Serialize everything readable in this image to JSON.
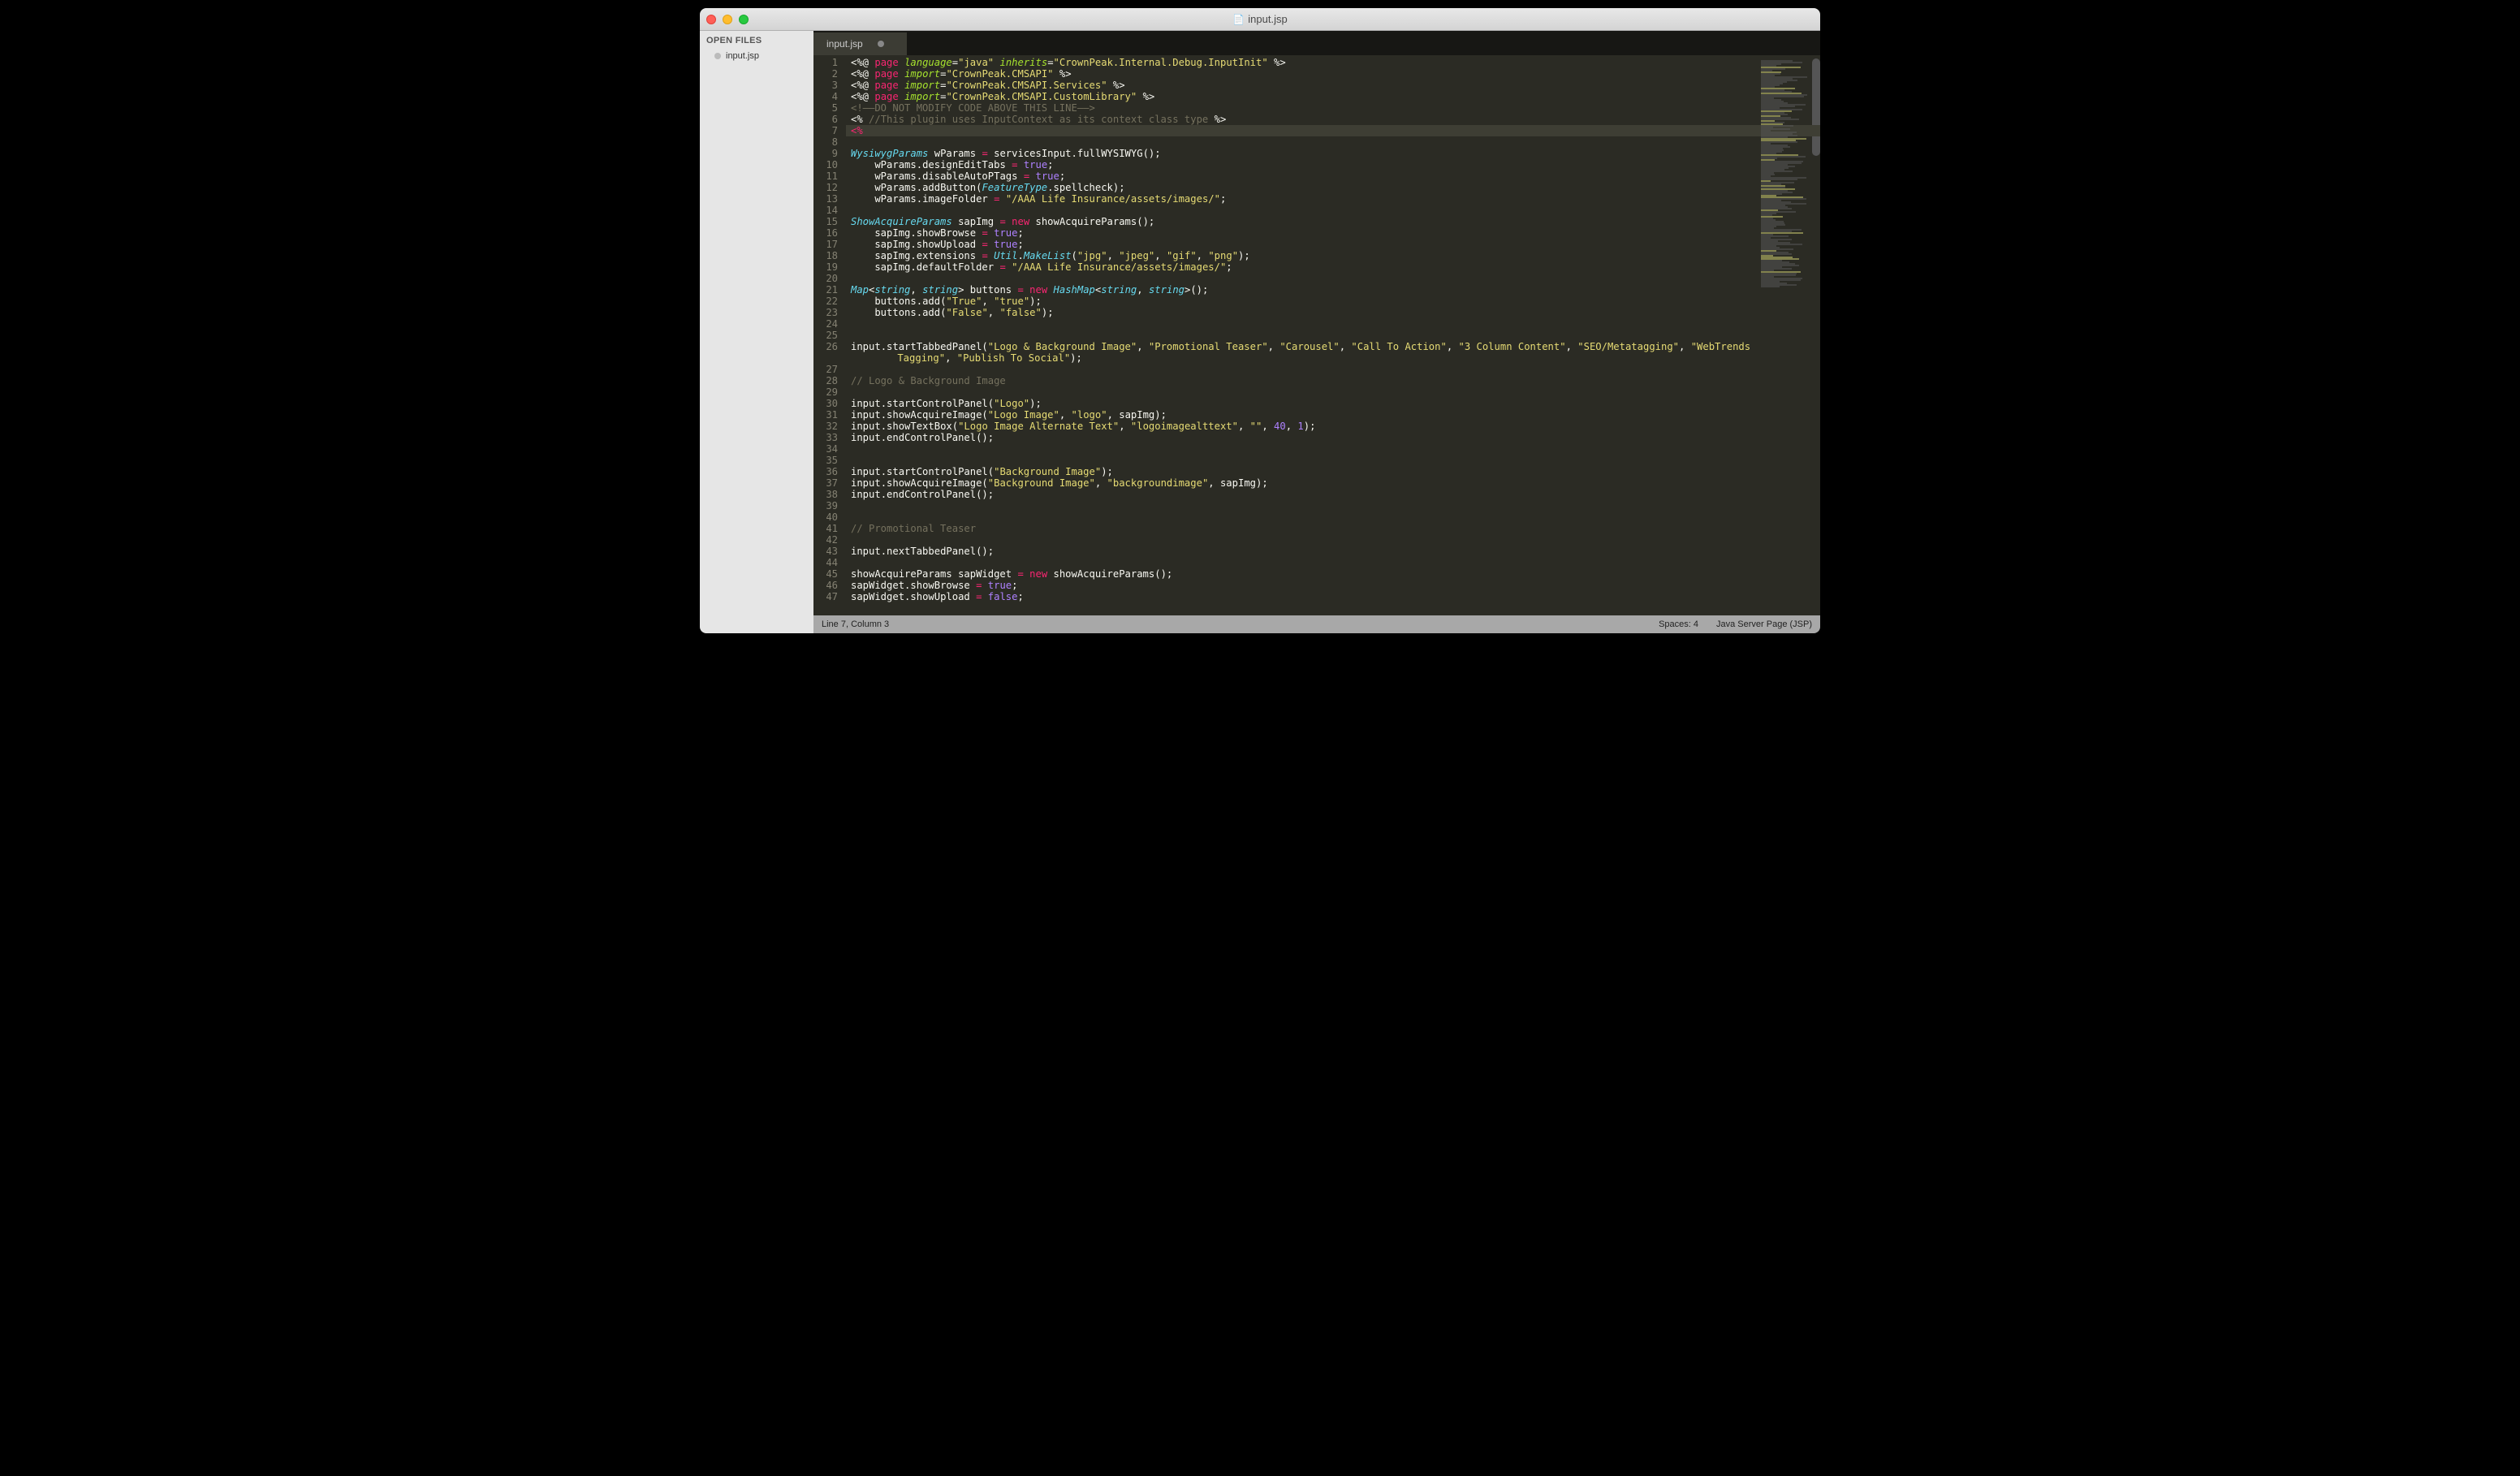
{
  "window": {
    "title": "input.jsp"
  },
  "sidebar": {
    "header": "OPEN FILES",
    "items": [
      "input.jsp"
    ]
  },
  "tab": {
    "label": "input.jsp"
  },
  "status": {
    "left": "Line 7, Column 3",
    "spaces": "Spaces: 4",
    "syntax": "Java Server Page (JSP)"
  },
  "highlight_line": 7,
  "gutter": [
    "1",
    "2",
    "3",
    "4",
    "5",
    "6",
    "7",
    "8",
    "9",
    "10",
    "11",
    "12",
    "13",
    "14",
    "15",
    "16",
    "17",
    "18",
    "19",
    "20",
    "21",
    "22",
    "23",
    "24",
    "25",
    "26",
    "",
    "27",
    "28",
    "29",
    "30",
    "31",
    "32",
    "33",
    "34",
    "35",
    "36",
    "37",
    "38",
    "39",
    "40",
    "41",
    "42",
    "43",
    "44",
    "45",
    "46",
    "47"
  ],
  "code": [
    [
      [
        "<%@ ",
        "t-tag"
      ],
      [
        "page",
        "t-key"
      ],
      [
        " ",
        ""
      ],
      [
        "language",
        "t-attr"
      ],
      [
        "=",
        ""
      ],
      [
        "\"java\"",
        "t-str"
      ],
      [
        " ",
        ""
      ],
      [
        "inherits",
        "t-attr"
      ],
      [
        "=",
        ""
      ],
      [
        "\"CrownPeak.Internal.Debug.InputInit\"",
        "t-str"
      ],
      [
        " %>",
        "t-tag"
      ]
    ],
    [
      [
        "<%@ ",
        "t-tag"
      ],
      [
        "page",
        "t-key"
      ],
      [
        " ",
        ""
      ],
      [
        "import",
        "t-attr"
      ],
      [
        "=",
        ""
      ],
      [
        "\"CrownPeak.CMSAPI\"",
        "t-str"
      ],
      [
        " %>",
        "t-tag"
      ]
    ],
    [
      [
        "<%@ ",
        "t-tag"
      ],
      [
        "page",
        "t-key"
      ],
      [
        " ",
        ""
      ],
      [
        "import",
        "t-attr"
      ],
      [
        "=",
        ""
      ],
      [
        "\"CrownPeak.CMSAPI.Services\"",
        "t-str"
      ],
      [
        " %>",
        "t-tag"
      ]
    ],
    [
      [
        "<%@ ",
        "t-tag"
      ],
      [
        "page",
        "t-key"
      ],
      [
        " ",
        ""
      ],
      [
        "import",
        "t-attr"
      ],
      [
        "=",
        ""
      ],
      [
        "\"CrownPeak.CMSAPI.CustomLibrary\"",
        "t-str"
      ],
      [
        " %>",
        "t-tag"
      ]
    ],
    [
      [
        "<!——DO NOT MODIFY CODE ABOVE THIS LINE——>",
        "t-cmt"
      ]
    ],
    [
      [
        "<% ",
        "t-tag"
      ],
      [
        "//This plugin uses InputContext as its context class type",
        "t-cmt"
      ],
      [
        " %>",
        "t-tag"
      ]
    ],
    [
      [
        "<%",
        "t-key"
      ]
    ],
    [
      [
        "",
        ""
      ]
    ],
    [
      [
        "WysiwygParams",
        "t-type"
      ],
      [
        " wParams ",
        ""
      ],
      [
        "=",
        "t-key"
      ],
      [
        " servicesInput",
        ""
      ],
      [
        ".",
        "t-tag"
      ],
      [
        "fullWYSIWYG();",
        ""
      ]
    ],
    [
      [
        "    wParams",
        ""
      ],
      [
        ".",
        "t-tag"
      ],
      [
        "designEditTabs ",
        ""
      ],
      [
        "=",
        "t-key"
      ],
      [
        " ",
        ""
      ],
      [
        "true",
        "t-const"
      ],
      [
        ";",
        ""
      ]
    ],
    [
      [
        "    wParams",
        ""
      ],
      [
        ".",
        "t-tag"
      ],
      [
        "disableAutoPTags ",
        ""
      ],
      [
        "=",
        "t-key"
      ],
      [
        " ",
        ""
      ],
      [
        "true",
        "t-const"
      ],
      [
        ";",
        ""
      ]
    ],
    [
      [
        "    wParams",
        ""
      ],
      [
        ".",
        "t-tag"
      ],
      [
        "addButton(",
        ""
      ],
      [
        "FeatureType",
        "t-type"
      ],
      [
        ".",
        "t-tag"
      ],
      [
        "spellcheck);",
        ""
      ]
    ],
    [
      [
        "    wParams",
        ""
      ],
      [
        ".",
        "t-tag"
      ],
      [
        "imageFolder ",
        ""
      ],
      [
        "=",
        "t-key"
      ],
      [
        " ",
        ""
      ],
      [
        "\"/AAA Life Insurance/assets/images/\"",
        "t-str"
      ],
      [
        ";",
        ""
      ]
    ],
    [
      [
        "",
        ""
      ]
    ],
    [
      [
        "ShowAcquireParams",
        "t-type"
      ],
      [
        " sapImg ",
        ""
      ],
      [
        "=",
        "t-key"
      ],
      [
        " ",
        ""
      ],
      [
        "new",
        "t-key"
      ],
      [
        " showAcquireParams();",
        ""
      ]
    ],
    [
      [
        "    sapImg",
        ""
      ],
      [
        ".",
        "t-tag"
      ],
      [
        "showBrowse ",
        ""
      ],
      [
        "=",
        "t-key"
      ],
      [
        " ",
        ""
      ],
      [
        "true",
        "t-const"
      ],
      [
        ";",
        ""
      ]
    ],
    [
      [
        "    sapImg",
        ""
      ],
      [
        ".",
        "t-tag"
      ],
      [
        "showUpload ",
        ""
      ],
      [
        "=",
        "t-key"
      ],
      [
        " ",
        ""
      ],
      [
        "true",
        "t-const"
      ],
      [
        ";",
        ""
      ]
    ],
    [
      [
        "    sapImg",
        ""
      ],
      [
        ".",
        "t-tag"
      ],
      [
        "extensions ",
        ""
      ],
      [
        "=",
        "t-key"
      ],
      [
        " ",
        ""
      ],
      [
        "Util",
        "t-type"
      ],
      [
        ".",
        "t-tag"
      ],
      [
        "MakeList",
        "t-type"
      ],
      [
        "(",
        ""
      ],
      [
        "\"jpg\"",
        "t-str"
      ],
      [
        ", ",
        ""
      ],
      [
        "\"jpeg\"",
        "t-str"
      ],
      [
        ", ",
        ""
      ],
      [
        "\"gif\"",
        "t-str"
      ],
      [
        ", ",
        ""
      ],
      [
        "\"png\"",
        "t-str"
      ],
      [
        ");",
        ""
      ]
    ],
    [
      [
        "    sapImg",
        ""
      ],
      [
        ".",
        "t-tag"
      ],
      [
        "defaultFolder ",
        ""
      ],
      [
        "=",
        "t-key"
      ],
      [
        " ",
        ""
      ],
      [
        "\"/AAA Life Insurance/assets/images/\"",
        "t-str"
      ],
      [
        ";",
        ""
      ]
    ],
    [
      [
        "",
        ""
      ]
    ],
    [
      [
        "Map",
        "t-type"
      ],
      [
        "<",
        "t-tag"
      ],
      [
        "string",
        "t-type"
      ],
      [
        ",",
        "t-tag"
      ],
      [
        " ",
        ""
      ],
      [
        "string",
        "t-type"
      ],
      [
        "> buttons ",
        ""
      ],
      [
        "=",
        "t-key"
      ],
      [
        " ",
        ""
      ],
      [
        "new",
        "t-key"
      ],
      [
        " ",
        ""
      ],
      [
        "HashMap",
        "t-type"
      ],
      [
        "<",
        "t-tag"
      ],
      [
        "string",
        "t-type"
      ],
      [
        ",",
        "t-tag"
      ],
      [
        " ",
        ""
      ],
      [
        "string",
        "t-type"
      ],
      [
        ">();",
        ""
      ]
    ],
    [
      [
        "    buttons",
        ""
      ],
      [
        ".",
        "t-tag"
      ],
      [
        "add(",
        ""
      ],
      [
        "\"True\"",
        "t-str"
      ],
      [
        ", ",
        ""
      ],
      [
        "\"true\"",
        "t-str"
      ],
      [
        ");",
        ""
      ]
    ],
    [
      [
        "    buttons",
        ""
      ],
      [
        ".",
        "t-tag"
      ],
      [
        "add(",
        ""
      ],
      [
        "\"False\"",
        "t-str"
      ],
      [
        ", ",
        ""
      ],
      [
        "\"false\"",
        "t-str"
      ],
      [
        ");",
        ""
      ]
    ],
    [
      [
        "",
        ""
      ]
    ],
    [
      [
        "",
        ""
      ]
    ],
    [
      [
        "input",
        ""
      ],
      [
        ".",
        "t-tag"
      ],
      [
        "startTabbedPanel(",
        ""
      ],
      [
        "\"Logo & Background Image\"",
        "t-str"
      ],
      [
        ", ",
        ""
      ],
      [
        "\"Promotional Teaser\"",
        "t-str"
      ],
      [
        ", ",
        ""
      ],
      [
        "\"Carousel\"",
        "t-str"
      ],
      [
        ", ",
        ""
      ],
      [
        "\"Call To Action\"",
        "t-str"
      ],
      [
        ", ",
        ""
      ],
      [
        "\"3 Column Content\"",
        "t-str"
      ],
      [
        ", ",
        ""
      ],
      [
        "\"SEO/Metatagging\"",
        "t-str"
      ],
      [
        ", ",
        ""
      ],
      [
        "\"WebTrends ",
        "t-str"
      ]
    ],
    [
      [
        "    Tagging\"",
        "t-str"
      ],
      [
        ", ",
        ""
      ],
      [
        "\"Publish To Social\"",
        "t-str"
      ],
      [
        ");",
        ""
      ]
    ],
    [
      [
        "",
        ""
      ]
    ],
    [
      [
        "// Logo & Background Image",
        "t-cmt"
      ]
    ],
    [
      [
        "",
        ""
      ]
    ],
    [
      [
        "input",
        ""
      ],
      [
        ".",
        "t-tag"
      ],
      [
        "startControlPanel(",
        ""
      ],
      [
        "\"Logo\"",
        "t-str"
      ],
      [
        ");",
        ""
      ]
    ],
    [
      [
        "input",
        ""
      ],
      [
        ".",
        "t-tag"
      ],
      [
        "showAcquireImage(",
        ""
      ],
      [
        "\"Logo Image\"",
        "t-str"
      ],
      [
        ", ",
        ""
      ],
      [
        "\"logo\"",
        "t-str"
      ],
      [
        ", sapImg);",
        ""
      ]
    ],
    [
      [
        "input",
        ""
      ],
      [
        ".",
        "t-tag"
      ],
      [
        "showTextBox(",
        ""
      ],
      [
        "\"Logo Image Alternate Text\"",
        "t-str"
      ],
      [
        ", ",
        ""
      ],
      [
        "\"logoimagealttext\"",
        "t-str"
      ],
      [
        ", ",
        ""
      ],
      [
        "\"\"",
        "t-str"
      ],
      [
        ", ",
        ""
      ],
      [
        "40",
        "t-num"
      ],
      [
        ", ",
        ""
      ],
      [
        "1",
        "t-num"
      ],
      [
        ");",
        ""
      ]
    ],
    [
      [
        "input",
        ""
      ],
      [
        ".",
        "t-tag"
      ],
      [
        "endControlPanel();",
        ""
      ]
    ],
    [
      [
        "",
        ""
      ]
    ],
    [
      [
        "",
        ""
      ]
    ],
    [
      [
        "input",
        ""
      ],
      [
        ".",
        "t-tag"
      ],
      [
        "startControlPanel(",
        ""
      ],
      [
        "\"Background Image\"",
        "t-str"
      ],
      [
        ");",
        ""
      ]
    ],
    [
      [
        "input",
        ""
      ],
      [
        ".",
        "t-tag"
      ],
      [
        "showAcquireImage(",
        ""
      ],
      [
        "\"Background Image\"",
        "t-str"
      ],
      [
        ", ",
        ""
      ],
      [
        "\"backgroundimage\"",
        "t-str"
      ],
      [
        ", sapImg);",
        ""
      ]
    ],
    [
      [
        "input",
        ""
      ],
      [
        ".",
        "t-tag"
      ],
      [
        "endControlPanel();",
        ""
      ]
    ],
    [
      [
        "",
        ""
      ]
    ],
    [
      [
        "",
        ""
      ]
    ],
    [
      [
        "// Promotional Teaser",
        "t-cmt"
      ]
    ],
    [
      [
        "",
        ""
      ]
    ],
    [
      [
        "input",
        ""
      ],
      [
        ".",
        "t-tag"
      ],
      [
        "nextTabbedPanel();",
        ""
      ]
    ],
    [
      [
        "",
        ""
      ]
    ],
    [
      [
        "showAcquireParams sapWidget ",
        ""
      ],
      [
        "=",
        "t-key"
      ],
      [
        " ",
        ""
      ],
      [
        "new",
        "t-key"
      ],
      [
        " showAcquireParams();",
        ""
      ]
    ],
    [
      [
        "sapWidget",
        ""
      ],
      [
        ".",
        "t-tag"
      ],
      [
        "showBrowse ",
        ""
      ],
      [
        "=",
        "t-key"
      ],
      [
        " ",
        ""
      ],
      [
        "true",
        "t-const"
      ],
      [
        ";",
        ""
      ]
    ],
    [
      [
        "sapWidget",
        ""
      ],
      [
        ".",
        "t-tag"
      ],
      [
        "showUpload ",
        ""
      ],
      [
        "=",
        "t-key"
      ],
      [
        " ",
        ""
      ],
      [
        "false",
        "t-const"
      ],
      [
        ";",
        ""
      ]
    ]
  ]
}
